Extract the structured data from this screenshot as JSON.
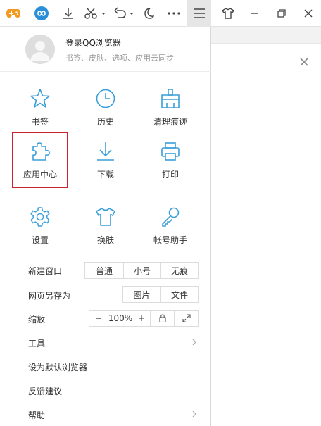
{
  "colors": {
    "accent": "#3a9fd8",
    "highlight": "#c9242b",
    "toolbar_bg": "#ffffff",
    "active_btn_bg": "#e6e6e6"
  },
  "toolbar": {
    "icons": [
      "gamepad-icon",
      "infinity-icon",
      "download-icon",
      "scissors-icon",
      "undo-icon",
      "moon-icon",
      "more-icon",
      "menu-icon",
      "shirt-icon",
      "restore-icon",
      "close-icon"
    ]
  },
  "user": {
    "login": "登录QQ浏览器",
    "subtitle": "书签、皮肤、选项、应用云同步"
  },
  "grid": [
    {
      "label": "书签",
      "icon": "star-icon"
    },
    {
      "label": "历史",
      "icon": "clock-icon"
    },
    {
      "label": "清理痕迹",
      "icon": "broom-icon"
    },
    {
      "label": "应用中心",
      "icon": "puzzle-icon"
    },
    {
      "label": "下载",
      "icon": "download-icon"
    },
    {
      "label": "打印",
      "icon": "printer-icon"
    },
    {
      "label": "设置",
      "icon": "gear-icon"
    },
    {
      "label": "换肤",
      "icon": "shirt-icon"
    },
    {
      "label": "帐号助手",
      "icon": "key-icon"
    }
  ],
  "new_window": {
    "label": "新建窗口",
    "options": [
      "普通",
      "小号",
      "无痕"
    ]
  },
  "save_as": {
    "label": "网页另存为",
    "options": [
      "图片",
      "文件"
    ]
  },
  "zoom": {
    "label": "缩放",
    "minus": "−",
    "value": "100%",
    "plus": "+"
  },
  "menu": {
    "tools": "工具",
    "default_browser": "设为默认浏览器",
    "feedback": "反馈建议",
    "help": "帮助"
  }
}
